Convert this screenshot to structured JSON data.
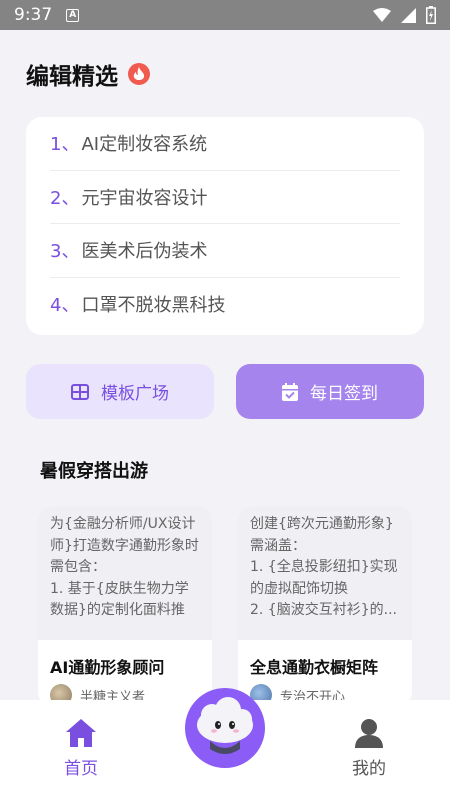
{
  "status_bar": {
    "time": "9:37",
    "notif_letter": "A"
  },
  "featured": {
    "title": "编辑精选",
    "items": [
      {
        "num": "1、",
        "text": "AI定制妆容系统"
      },
      {
        "num": "2、",
        "text": "元宇宙妆容设计"
      },
      {
        "num": "3、",
        "text": "医美术后伪装术"
      },
      {
        "num": "4、",
        "text": "口罩不脱妆黑科技"
      }
    ]
  },
  "actions": {
    "template_label": "模板广场",
    "checkin_label": "每日签到"
  },
  "summer": {
    "title": "暑假穿搭出游",
    "posts": [
      {
        "body": "为{金融分析师/UX设计师}打造数字通勤形象时需包含：\n1. 基于{皮肤生物力学数据}的定制化面料推",
        "title": "AI通勤形象顾问",
        "author": "半糖主义者"
      },
      {
        "body": "创建{跨次元通勤形象}需涵盖：\n1. {全息投影纽扣}实现的虚拟配饰切换\n2. {脑波交互衬衫}的...",
        "title": "全息通勤衣橱矩阵",
        "author": "专治不开心"
      }
    ]
  },
  "tabs": {
    "home": "首页",
    "mine": "我的"
  },
  "colors": {
    "accent": "#7a4fe0",
    "accent_light": "#e9e3fd",
    "checkin_bg": "#a684ee",
    "fire": "#f15a4e"
  }
}
